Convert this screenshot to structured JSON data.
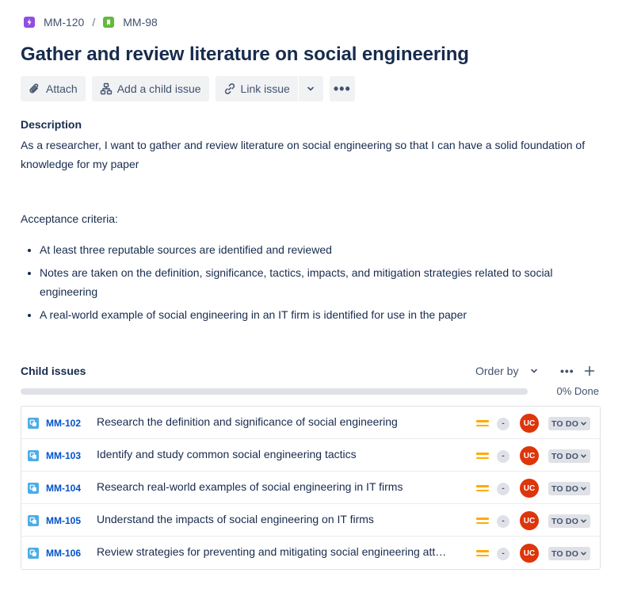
{
  "breadcrumbs": [
    {
      "key": "MM-120",
      "color": "#904ee2",
      "icon": "epic-icon"
    },
    {
      "key": "MM-98",
      "color": "#63ba3c",
      "icon": "story-icon"
    }
  ],
  "breadcrumb_separator": "/",
  "issue": {
    "title": "Gather and review literature on social engineering"
  },
  "toolbar": {
    "attach_label": "Attach",
    "add_child_label": "Add a child issue",
    "link_issue_label": "Link issue",
    "more_label": "•••"
  },
  "description": {
    "label": "Description",
    "text": "As a researcher, I want to gather and review literature on social engineering so that I can have a solid foundation of knowledge for my paper",
    "acceptance_label": "Acceptance criteria:",
    "criteria": [
      "At least three reputable sources are identified and reviewed",
      "Notes are taken on the definition, significance, tactics, impacts, and mitigation strategies related to social engineering",
      "A real-world example of social engineering in an IT firm is identified for use in the paper"
    ]
  },
  "child_issues": {
    "title": "Child issues",
    "order_by_label": "Order by",
    "more_label": "•••",
    "progress_fraction": 0,
    "progress_label": "0% Done",
    "items": [
      {
        "key": "MM-102",
        "summary": "Research the definition and significance of social engineering",
        "estimate": "-",
        "assignee_initials": "UC",
        "status": "TO DO"
      },
      {
        "key": "MM-103",
        "summary": "Identify and study common social engineering tactics",
        "estimate": "-",
        "assignee_initials": "UC",
        "status": "TO DO"
      },
      {
        "key": "MM-104",
        "summary": "Research real-world examples of social engineering in IT firms",
        "estimate": "-",
        "assignee_initials": "UC",
        "status": "TO DO"
      },
      {
        "key": "MM-105",
        "summary": "Understand the impacts of social engineering on IT firms",
        "estimate": "-",
        "assignee_initials": "UC",
        "status": "TO DO"
      },
      {
        "key": "MM-106",
        "summary": "Review strategies for preventing and mitigating social engineering att…",
        "estimate": "-",
        "assignee_initials": "UC",
        "status": "TO DO"
      }
    ]
  },
  "colors": {
    "link": "#0052cc",
    "priority_medium": "#ffab00",
    "avatar": "#de350b",
    "subtask_icon": "#4bade8",
    "progress_done": "#36b37e",
    "progress_track": "#dfe1e6"
  }
}
